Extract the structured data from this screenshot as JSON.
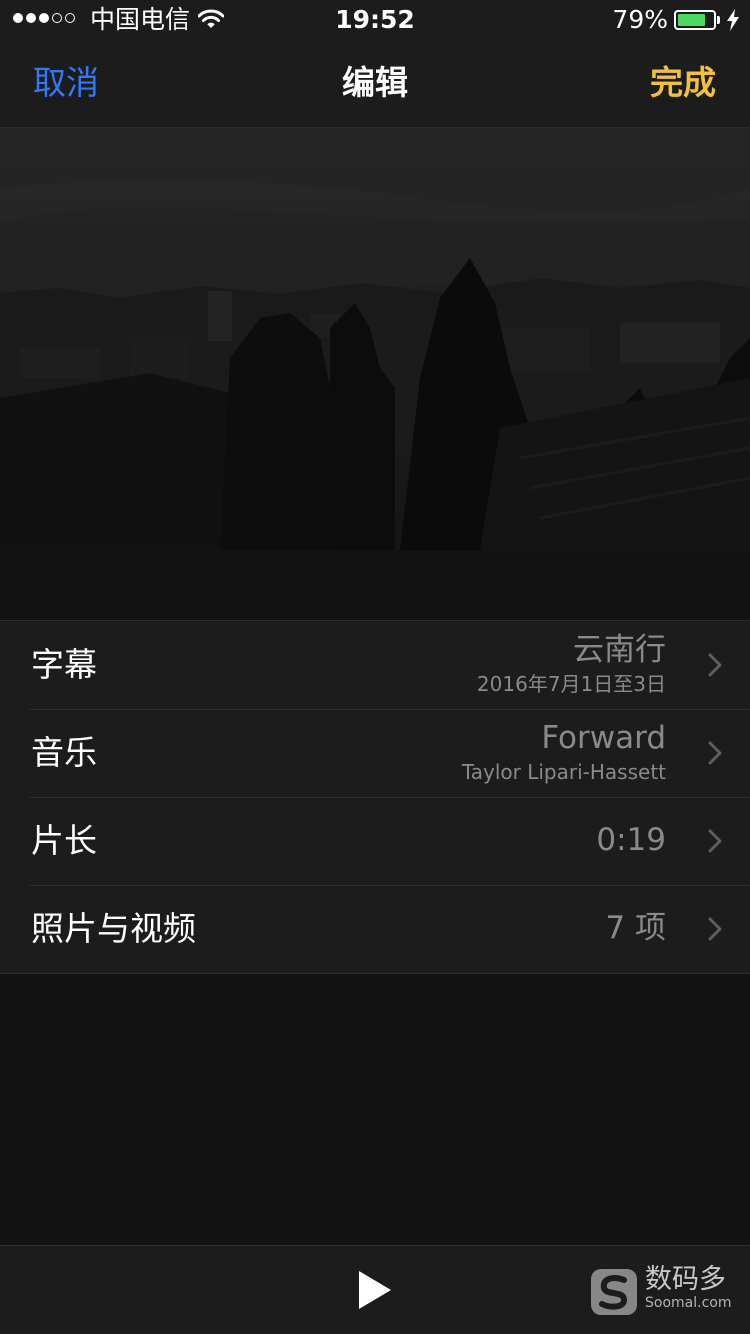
{
  "status_bar": {
    "signal_bars_filled": 3,
    "signal_bars_total": 5,
    "carrier": "中国电信",
    "time": "19:52",
    "battery_text": "79%",
    "battery_level": 0.79,
    "battery_color": "#4cd964",
    "icons": [
      "wifi-icon",
      "battery-icon",
      "charging-bolt-icon"
    ]
  },
  "nav": {
    "cancel_label": "取消",
    "title": "编辑",
    "done_label": "完成",
    "cancel_color": "#3478f6",
    "done_color": "#f2c13c"
  },
  "list": [
    {
      "label": "字幕",
      "value": "云南行",
      "subtitle": "2016年7月1日至3日"
    },
    {
      "label": "音乐",
      "value": "Forward",
      "subtitle": "Taylor Lipari-Hassett"
    },
    {
      "label": "片长",
      "value": "0:19"
    },
    {
      "label": "照片与视频",
      "value": "7 项"
    }
  ],
  "toolbar": {
    "play_icon": "play-icon"
  },
  "watermark": {
    "name": "数码多",
    "site": "Soomal.com"
  }
}
